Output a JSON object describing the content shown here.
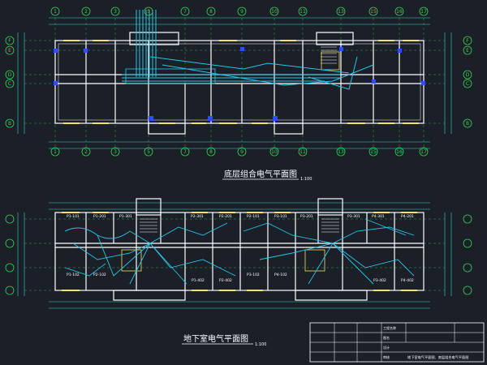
{
  "plans": {
    "top_title": "底层组合电气平面图",
    "top_scale": "1:100",
    "bottom_title": "地下室电气平面图",
    "bottom_scale": "1:100"
  },
  "axes": {
    "top_labels": [
      "1",
      "2",
      "3",
      "5",
      "7",
      "8",
      "9",
      "10",
      "11",
      "13",
      "15",
      "16",
      "17"
    ],
    "left_labels": [
      "F",
      "E",
      "D",
      "C",
      "B"
    ],
    "bottom_labels": [
      "1",
      "2",
      "3",
      "4",
      "5",
      "6",
      "7",
      "8",
      "9",
      "10",
      "11",
      "12",
      "13",
      "14",
      "15",
      "16",
      "17"
    ]
  },
  "rooms": {
    "top_left": [
      "P1-101",
      "P1-201",
      "P1-301",
      "P2-301",
      "P2-201",
      "P2-101"
    ],
    "top_right": [
      "P3-101",
      "P3-201",
      "P3-301",
      "P4-301",
      "P4-201",
      "P4-101"
    ],
    "bottom_left": [
      "P1-102",
      "P2-102",
      "P1-402",
      "P2-402"
    ],
    "bottom_right": [
      "P3-102",
      "P4-102",
      "P3-402",
      "P4-402"
    ]
  },
  "title_block": {
    "rows": [
      "工程名称",
      "图名",
      "设计",
      "审核"
    ],
    "drawing_name": "地下室电气平面图、底层组合电气平面图"
  },
  "colors": {
    "background": "#1a1f28",
    "wall": "#ffffff",
    "axis": "#39d353",
    "wiring": "#29c5e6",
    "dimension": "#3bd1c7",
    "window": "#f5e06a",
    "blue": "#2a4fff"
  }
}
